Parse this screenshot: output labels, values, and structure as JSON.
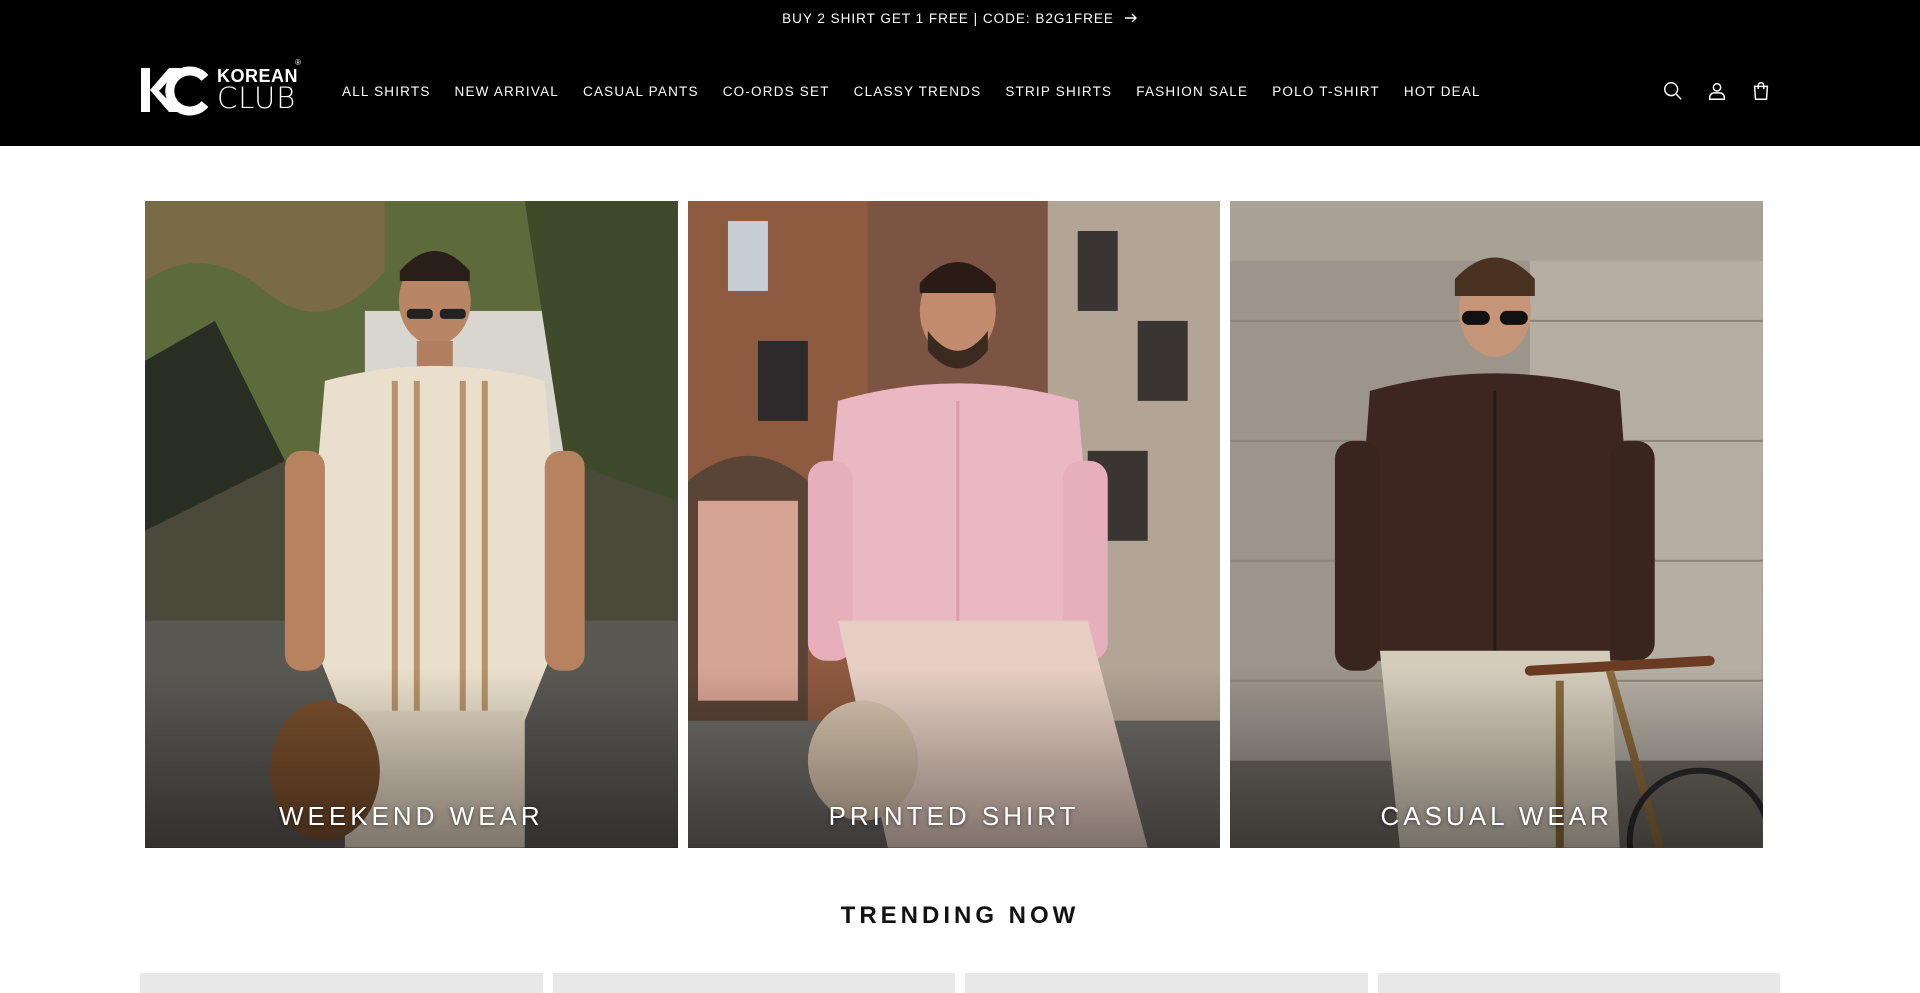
{
  "announcement": {
    "text": "BUY 2 SHIRT GET 1 FREE | CODE: B2G1FREE",
    "arrow_icon": "arrow-right-icon"
  },
  "logo": {
    "mark": "KC",
    "top_text": "KOREAN",
    "bottom_text": "CLUB",
    "registered": "®"
  },
  "nav": {
    "items": [
      {
        "label": "ALL SHIRTS"
      },
      {
        "label": "NEW ARRIVAL"
      },
      {
        "label": "CASUAL PANTS"
      },
      {
        "label": "CO-ORDS SET"
      },
      {
        "label": "CLASSY TRENDS"
      },
      {
        "label": "STRIP SHIRTS"
      },
      {
        "label": "FASHION SALE"
      },
      {
        "label": "POLO T-SHIRT"
      },
      {
        "label": "HOT DEAL"
      }
    ]
  },
  "header_icons": [
    "search-icon",
    "account-icon",
    "cart-icon"
  ],
  "collections": [
    {
      "title": "WEEKEND WEAR"
    },
    {
      "title": "PRINTED SHIRT"
    },
    {
      "title": "CASUAL WEAR"
    }
  ],
  "trending": {
    "title": "TRENDING NOW"
  },
  "colors": {
    "header_bg": "#000000",
    "page_bg": "#ffffff",
    "text": "#121212"
  }
}
